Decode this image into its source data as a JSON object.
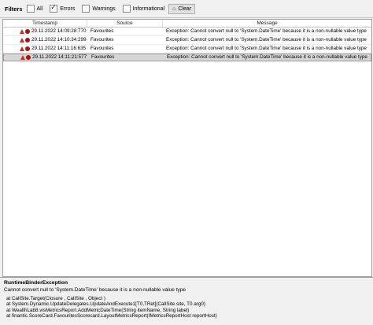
{
  "filters": {
    "label": "Filters",
    "options": [
      {
        "label": "All",
        "checked": false
      },
      {
        "label": "Errors",
        "checked": true
      },
      {
        "label": "Warnings",
        "checked": false
      },
      {
        "label": "Informational",
        "checked": false
      }
    ],
    "clear_label": "Clear"
  },
  "grid": {
    "columns": [
      "Timestamp",
      "Source",
      "Message"
    ],
    "rows": [
      {
        "timestamp": "29.11.2022 14:09:28:770",
        "source": "Favourites",
        "message": "Exception: Cannot convert null to 'System.DateTime' because it is a non-nullable value type"
      },
      {
        "timestamp": "29.11.2022 14:10:34:299",
        "source": "Favourites",
        "message": "Exception: Cannot convert null to 'System.DateTime' because it is a non-nullable value type"
      },
      {
        "timestamp": "29.11.2022 14:11:16:635",
        "source": "Favourites",
        "message": "Exception: Cannot convert null to 'System.DateTime' because it is a non-nullable value type"
      },
      {
        "timestamp": "29.11.2022 14:11:21:577",
        "source": "Favourites",
        "message": "Exception: Cannot convert null to 'System.DateTime' because it is a non-nullable value type"
      }
    ],
    "selected_row": 3
  },
  "detail": {
    "exception_type": "RuntimeBinderException",
    "message": "Cannot convert null to 'System.DateTime' because it is a non-nullable value type",
    "stack": [
      "at CallSite.Target(Closure , CallSite , Object )",
      "at System.Dynamic.UpdateDelegates.UpdateAndExecute1[T0,TRet](CallSite site, T0 arg0)",
      "at WealthLab8.visMetricsReport.AddMetricDateTime(String itemName, String label)",
      "at finantic.ScoreCard.FavouritesScorecard.LayoutMetricsReport(IMetricsReportHost reportHost)"
    ]
  }
}
